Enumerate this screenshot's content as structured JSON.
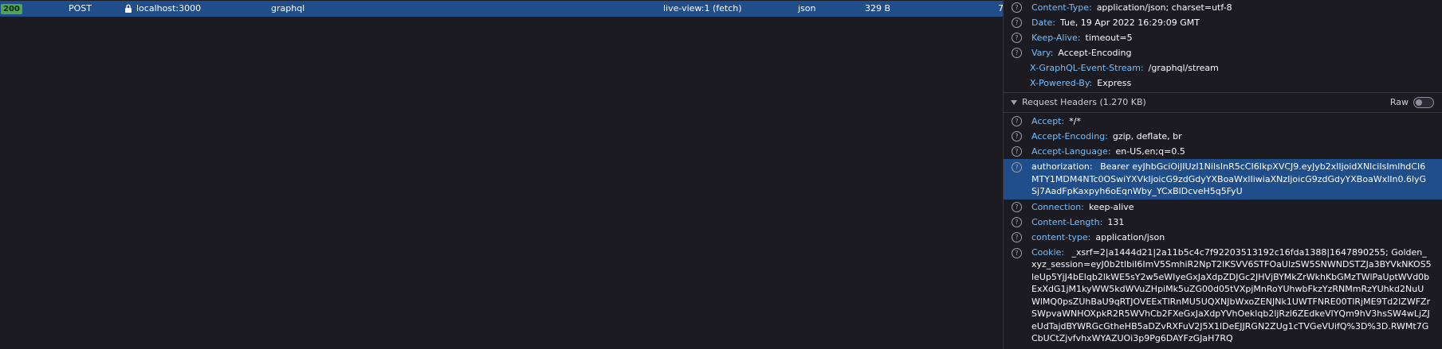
{
  "request_row": {
    "status": "200",
    "method": "POST",
    "domain": "localhost:3000",
    "file": "graphql",
    "initiator": "live-view:1 (fetch)",
    "type": "json",
    "size": "329 B",
    "cut": "7"
  },
  "response_headers": [
    {
      "name": "Content-Type:",
      "value": "application/json; charset=utf-8",
      "help": true
    },
    {
      "name": "Date:",
      "value": "Tue, 19 Apr 2022 16:29:09 GMT",
      "help": true
    },
    {
      "name": "Keep-Alive:",
      "value": "timeout=5",
      "help": true
    },
    {
      "name": "Vary:",
      "value": "Accept-Encoding",
      "help": true
    },
    {
      "name": "X-GraphQL-Event-Stream:",
      "value": "/graphql/stream",
      "help": false
    },
    {
      "name": "X-Powered-By:",
      "value": "Express",
      "help": false
    }
  ],
  "request_section": {
    "title": "Request Headers (1.270 KB)",
    "raw_label": "Raw"
  },
  "request_headers": {
    "accept": {
      "name": "Accept:",
      "value": "*/*"
    },
    "accept_encoding": {
      "name": "Accept-Encoding:",
      "value": "gzip, deflate, br"
    },
    "accept_language": {
      "name": "Accept-Language:",
      "value": "en-US,en;q=0.5"
    },
    "authorization": {
      "name": "authorization:",
      "value": "Bearer eyJhbGciOiJIUzI1NiIsInR5cCI6IkpXVCJ9.eyJyb2xlIjoidXNlciIsImlhdCI6MTY1MDM4NTc0OSwiYXVkIjoicG9zdGdyYXBoaWxlIiwiaXNzIjoicG9zdGdyYXBoaWxlIn0.6lyGSj7AadFpKaxpyh6oEqnWby_YCxBlDcveH5q5FyU"
    },
    "connection": {
      "name": "Connection:",
      "value": "keep-alive"
    },
    "content_length": {
      "name": "Content-Length:",
      "value": "131"
    },
    "content_type": {
      "name": "content-type:",
      "value": "application/json"
    },
    "cookie": {
      "name": "Cookie:",
      "value": "_xsrf=2|a1444d21|2a11b5c4c7f92203513192c16fda1388|1647890255; Golden_xyz_session=eyJ0b2tlbiI6ImV5SmhiR2NpT2lKSVV6STFOaUlzSW5SNWNDSTZJa3BYVkNKOS5leUp5YjJ4bElqb2lkWE5sY2w5eWIyeGxJaXdpZDJGc2JHVjBYMkZrWkhKbGMzTWlPaUptWVd0bExXdG1jM1kyWW5kdWVuZHpiMk5uZG00d05tVXpjMnRoYUhwbFkzYzRNMmRzYUhkd2NuUWlMQ0psZUhBaU9qRTJOVEExTlRnMU5UQXNJbWxoZENJNk1UWTFNRE00TlRjME9Td2lZWFZrSWpvaWNHOXpkR2R5WVhCb2FXeGxJaXdpYVhOeklqb2ljRzl6ZEdkeVlYQm9hV3hsSW4wLjZJeUdTajdBYWRGcGtheHB5aDZvRXFuV2J5X1lDeEJJRGN2ZUg1cTVGeVUifQ%3D%3D.RWMt7GCbUCtZjvfvhxWYAZUOi3p9Pg6DAYFzGJaH7RQ"
    }
  }
}
